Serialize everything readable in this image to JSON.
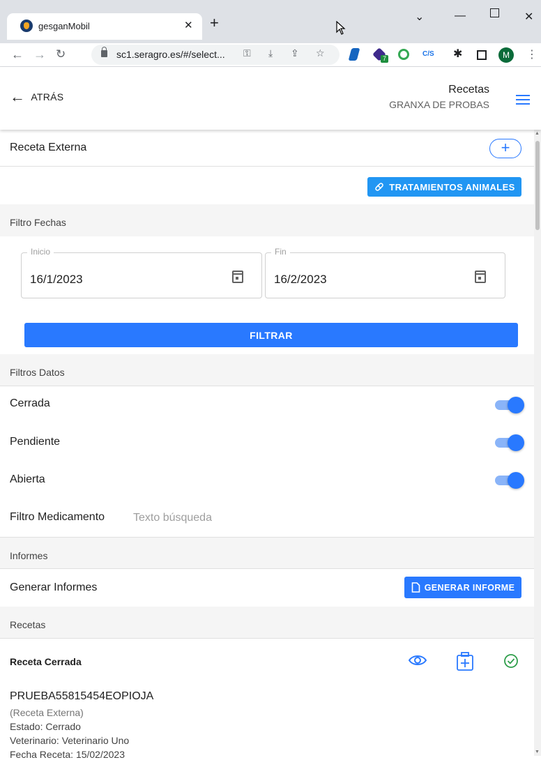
{
  "browser": {
    "tab_title": "gesganMobil",
    "url": "sc1.seragro.es/#/select...",
    "profile_initial": "M",
    "extension_label": "C/S",
    "extension_badge": "7"
  },
  "header": {
    "back_label": "ATRÁS",
    "title": "Recetas",
    "subtitle": "GRANXA DE PROBAS"
  },
  "receta_externa": {
    "label": "Receta Externa",
    "add_symbol": "+"
  },
  "tratamientos_button": "TRATAMIENTOS ANIMALES",
  "filtro_fechas": {
    "section_label": "Filtro Fechas",
    "inicio_label": "Inicio",
    "inicio_value": "16/1/2023",
    "fin_label": "Fin",
    "fin_value": "16/2/2023",
    "filtrar_button": "FILTRAR"
  },
  "filtros_datos": {
    "section_label": "Filtros Datos",
    "toggles": [
      {
        "label": "Cerrada",
        "checked": true
      },
      {
        "label": "Pendiente",
        "checked": true
      },
      {
        "label": "Abierta",
        "checked": true
      }
    ],
    "medicamento_label": "Filtro Medicamento",
    "medicamento_placeholder": "Texto búsqueda"
  },
  "informes": {
    "section_label": "Informes",
    "generar_label": "Generar Informes",
    "generar_button": "GENERAR INFORME"
  },
  "recetas": {
    "section_label": "Recetas",
    "items": [
      {
        "title": "Receta Cerrada",
        "code": "PRUEBA55815454EOPIOJA",
        "tipo": "(Receta Externa)",
        "estado": "Estado: Cerrado",
        "veterinario": "Veterinario: Veterinario Uno",
        "fecha": "Fecha Receta: 15/02/2023"
      }
    ]
  },
  "colors": {
    "accent": "#2979ff",
    "section_bg": "#f5f5f5",
    "status_ok": "#2e9e4a"
  }
}
